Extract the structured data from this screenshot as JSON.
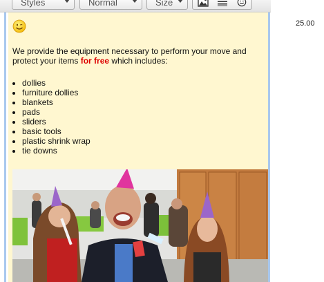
{
  "toolbar": {
    "styles_label": "Styles",
    "format_label": "Normal",
    "size_label": "Size",
    "buttons": [
      "image-icon",
      "horizontal-line-icon",
      "smiley-icon"
    ]
  },
  "editor": {
    "emoticon": "smiley-icon",
    "intro_before": "We provide the equipment necessary to perform your move and protect your items ",
    "intro_highlight": "for free",
    "intro_after": " which includes:",
    "items": [
      "dollies",
      "furniture dollies",
      "blankets",
      "pads",
      "sliders",
      "basic tools",
      "plastic shrink wrap",
      "tie downs"
    ],
    "photo": "party-photo"
  },
  "side": {
    "price": "25.00"
  },
  "colors": {
    "content_background": "#fff7d0",
    "highlight": "#dd0000",
    "editor_border": "#a9c8ee"
  }
}
